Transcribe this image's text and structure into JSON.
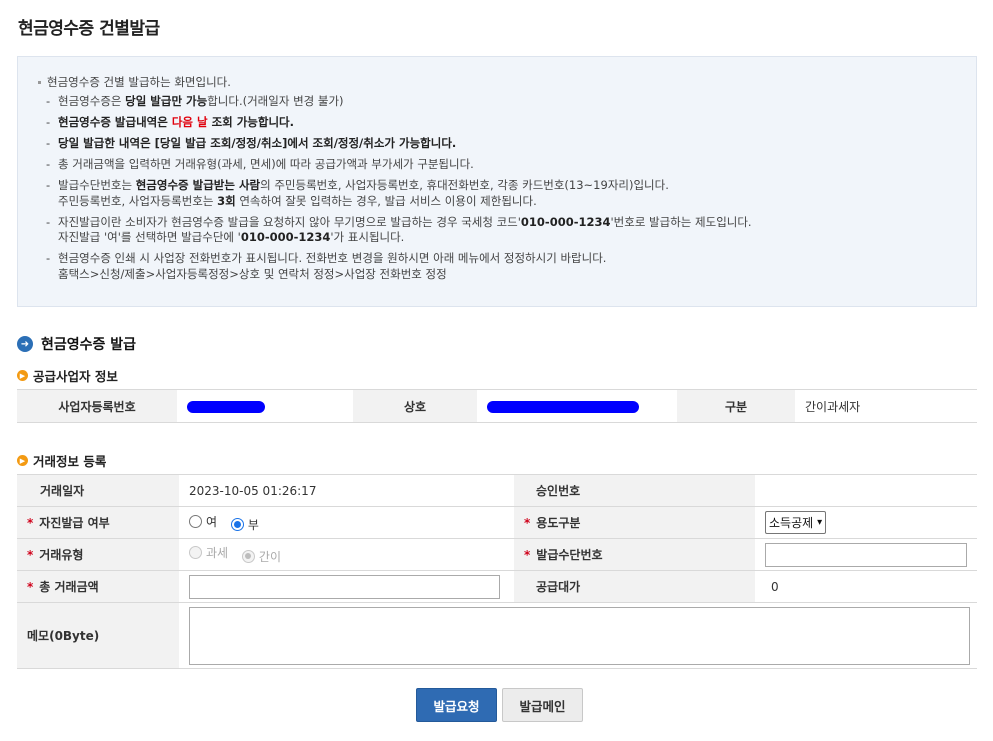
{
  "page": {
    "title": "현금영수증 건별발급"
  },
  "notice": {
    "intro": "현금영수증 건별 발급하는 화면입니다.",
    "items": [
      {
        "a": "현금영수증은 ",
        "b": "당일 발급만 가능",
        "c": "합니다.(거래일자 변경 불가)"
      },
      {
        "a": "현금영수증 발급내역은 ",
        "red": "다음 날",
        "c": " 조회 가능합니다."
      },
      {
        "bold": "당일 발급한 내역은 [당일 발급 조회/정정/취소]에서 조회/정정/취소가 가능합니다."
      },
      {
        "text": "총 거래금액을 입력하면 거래유형(과세, 면세)에 따라 공급가액과 부가세가 구분됩니다."
      },
      {
        "a": "발급수단번호는 ",
        "b": "현금영수증 발급받는 사람",
        "c": "의   주민등록번호, 사업자등록번호, 휴대전화번호, 각종 카드번호(13~19자리)입니다.",
        "line2a": "주민등록번호, 사업자등록번호는 ",
        "line2b": "3회",
        "line2c": " 연속하여 잘못 입력하는 경우, 발급 서비스 이용이 제한됩니다."
      },
      {
        "a": "자진발급이란 소비자가 현금영수증 발급을 요청하지 않아 무기명으로 발급하는 경우 국세청 코드'",
        "b": "010-000-1234",
        "c": "'번호로 발급하는 제도입니다.",
        "line2a": "자진발급 '여'를 선택하면 발급수단에 '",
        "line2b": "010-000-1234",
        "line2c": "'가 표시됩니다."
      },
      {
        "text": "현금영수증 인쇄 시 사업장 전화번호가 표시됩니다. 전화번호 변경을 원하시면 아래 메뉴에서 정정하시기 바랍니다.",
        "line2": "홈택스>신청/제출>사업자등록정정>상호 및 연락처 정정>사업장 전화번호 정정"
      }
    ]
  },
  "section": {
    "title": "현금영수증 발급"
  },
  "supplier": {
    "title": "공급사업자 정보",
    "brn_label": "사업자등록번호",
    "name_label": "상호",
    "type_label": "구분",
    "type_value": "간이과세자"
  },
  "trade": {
    "title": "거래정보 등록",
    "date_label": "거래일자",
    "date_value": "2023-10-05 01:26:17",
    "approval_label": "승인번호",
    "approval_value": "",
    "self_issue_label": "자진발급 여부",
    "self_issue_yes": "여",
    "self_issue_no": "부",
    "purpose_label": "용도구분",
    "purpose_value": "소득공제",
    "trade_type_label": "거래유형",
    "trade_type_taxable": "과세",
    "trade_type_simple": "간이",
    "means_label": "발급수단번호",
    "means_value": "",
    "total_label": "총 거래금액",
    "total_value": "",
    "supply_label": "공급대가",
    "supply_value": "0",
    "memo_label": "메모(0Byte)",
    "memo_value": ""
  },
  "buttons": {
    "request": "발급요청",
    "main": "발급메인"
  },
  "colors": {
    "primary": "#2f6bb3",
    "required": "#d0021b",
    "highlight": "#e0000c",
    "redaction": "#0000ff"
  }
}
